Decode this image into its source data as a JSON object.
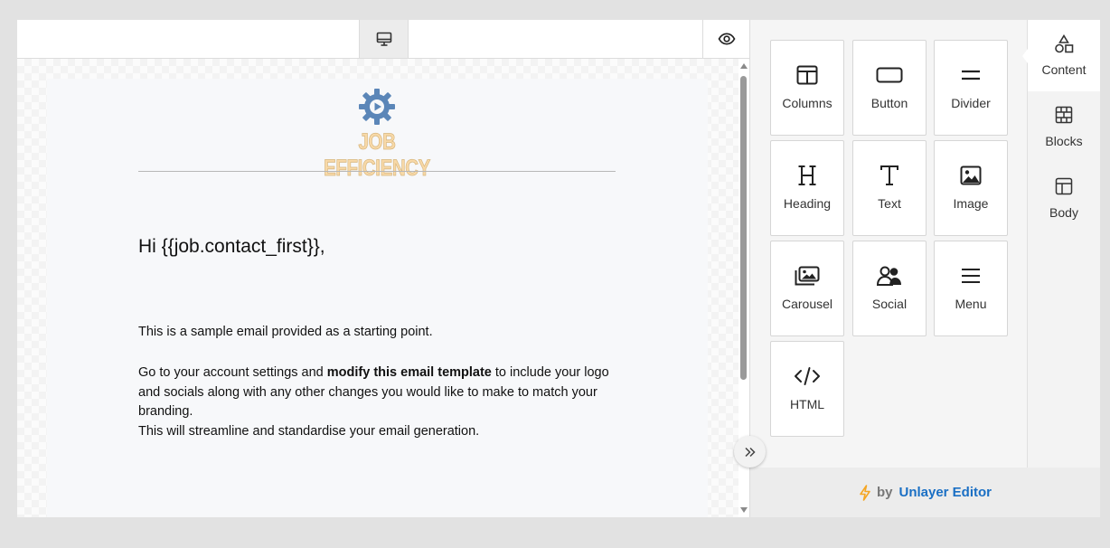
{
  "canvas": {
    "logo": {
      "text": "JOB EFFICIENCY",
      "gear_color": "#5b86b8",
      "text_color": "#f8d9a8"
    },
    "greeting": "Hi {{job.contact_first}},",
    "paragraph_1": "This is a sample email provided as a starting point.",
    "paragraph_2": {
      "before_bold": "Go to your account settings and ",
      "bold": "modify this email template",
      "after_bold": " to include your logo and socials along with any other changes you would like to make to match your branding.",
      "line_2": "This will streamline and standardise your email generation."
    }
  },
  "toolbar": {
    "device_icon": "desktop-monitor-icon",
    "preview_icon": "eye-icon"
  },
  "tools": [
    {
      "label": "Columns",
      "icon": "columns-icon"
    },
    {
      "label": "Button",
      "icon": "button-icon"
    },
    {
      "label": "Divider",
      "icon": "divider-icon"
    },
    {
      "label": "Heading",
      "icon": "heading-icon"
    },
    {
      "label": "Text",
      "icon": "text-icon"
    },
    {
      "label": "Image",
      "icon": "image-icon"
    },
    {
      "label": "Carousel",
      "icon": "carousel-icon"
    },
    {
      "label": "Social",
      "icon": "social-icon"
    },
    {
      "label": "Menu",
      "icon": "menu-icon"
    },
    {
      "label": "HTML",
      "icon": "code-icon"
    }
  ],
  "side_tabs": [
    {
      "label": "Content",
      "icon": "shapes-icon",
      "active": true
    },
    {
      "label": "Blocks",
      "icon": "blocks-icon",
      "active": false
    },
    {
      "label": "Body",
      "icon": "layout-icon",
      "active": false
    }
  ],
  "footer": {
    "by": "by",
    "link": "Unlayer Editor",
    "bolt_color": "#f5a623",
    "link_color": "#1a6fc4"
  }
}
